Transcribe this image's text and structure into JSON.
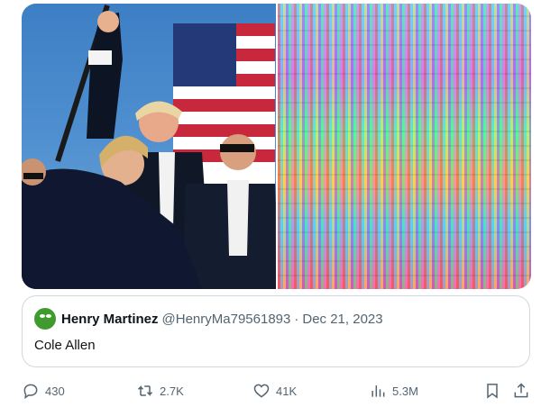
{
  "media": {
    "left_image_icon": "photo-image",
    "right_image_icon": "glitch-art-image"
  },
  "quoted_tweet": {
    "name": "Henry Martinez",
    "handle": "@HenryMa79561893",
    "separator": "·",
    "date": "Dec 21, 2023",
    "text": "Cole Allen",
    "avatar_icon": "frog-avatar-icon"
  },
  "actions": {
    "replies": "430",
    "reposts": "2.7K",
    "likes": "41K",
    "views": "5.3M"
  },
  "colors": {
    "text": "#0f1419",
    "muted": "#536471",
    "border": "#cfd9de"
  }
}
